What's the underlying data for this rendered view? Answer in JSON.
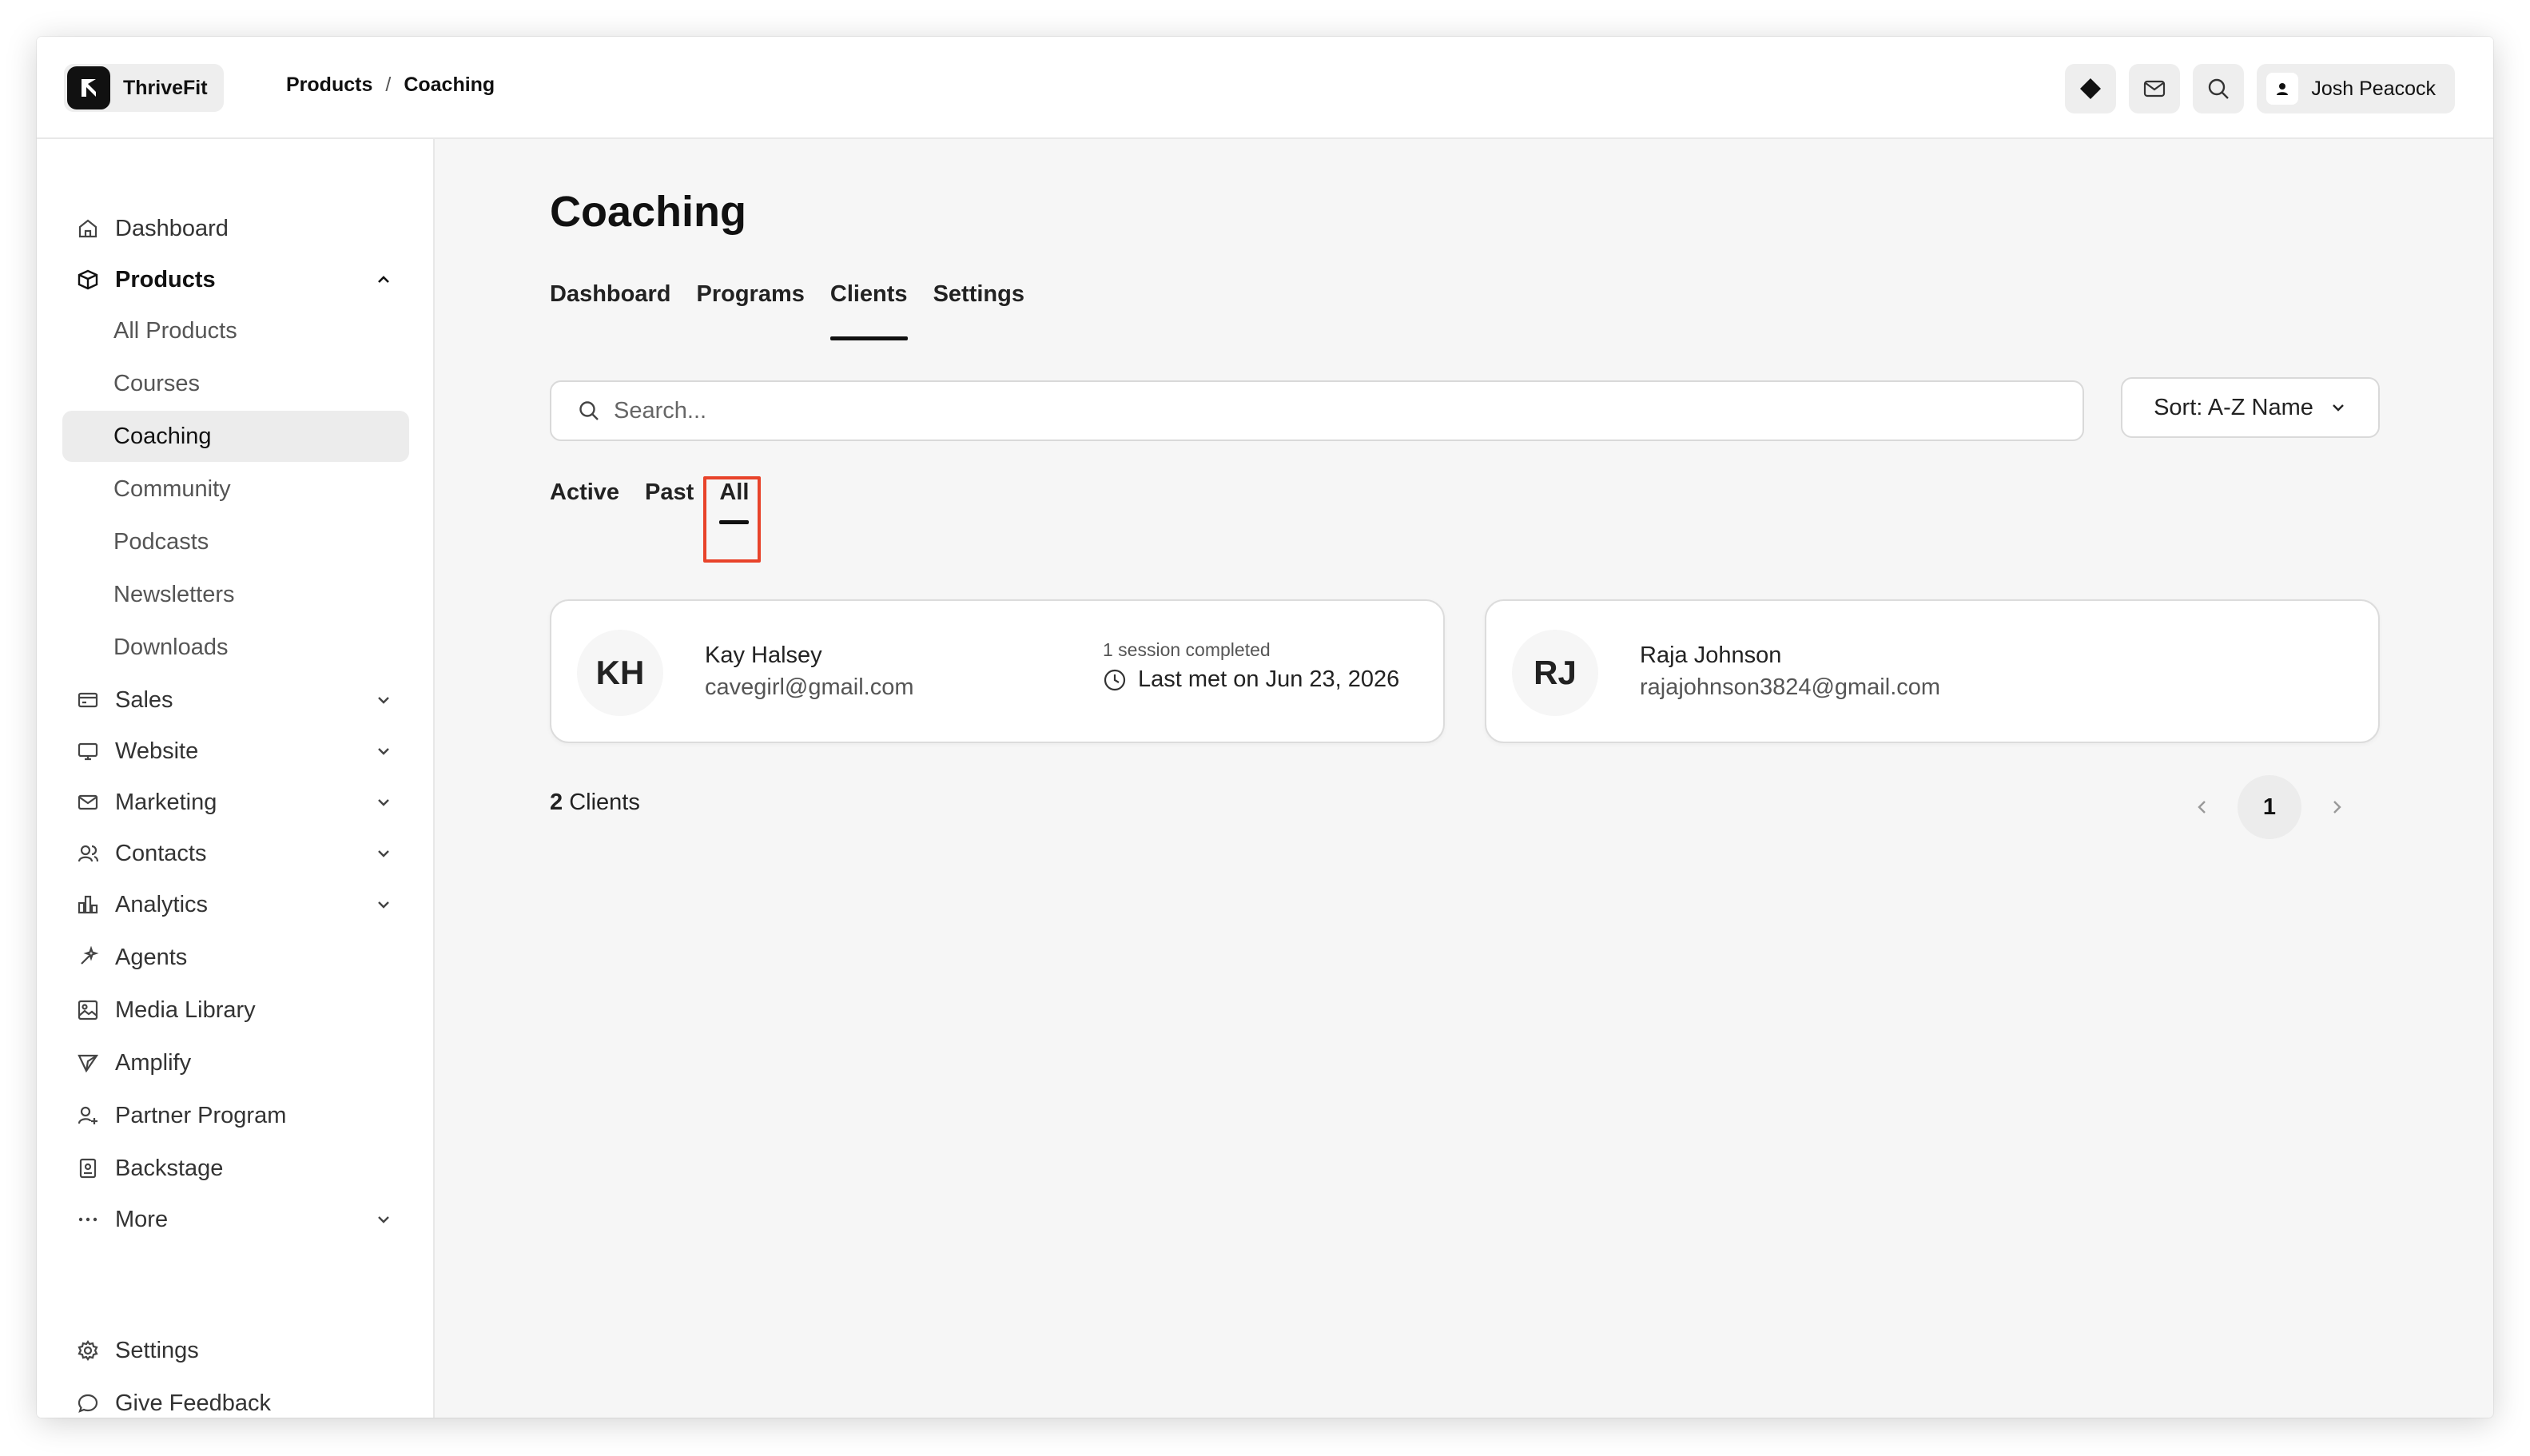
{
  "app": {
    "name": "ThriveFit"
  },
  "breadcrumb": {
    "items": [
      "Products",
      "Coaching"
    ],
    "separator": "/"
  },
  "user": {
    "name": "Josh Peacock"
  },
  "sidebar": {
    "items": [
      {
        "label": "Dashboard",
        "icon": "home-icon"
      },
      {
        "label": "Products",
        "icon": "box-icon",
        "expanded": true
      },
      {
        "label": "Sales",
        "icon": "credit-card-icon"
      },
      {
        "label": "Website",
        "icon": "monitor-icon"
      },
      {
        "label": "Marketing",
        "icon": "mail-icon"
      },
      {
        "label": "Contacts",
        "icon": "users-icon"
      },
      {
        "label": "Analytics",
        "icon": "bar-chart-icon"
      },
      {
        "label": "Agents",
        "icon": "sparkle-icon"
      },
      {
        "label": "Media Library",
        "icon": "image-icon"
      },
      {
        "label": "Amplify",
        "icon": "send-icon"
      },
      {
        "label": "Partner Program",
        "icon": "user-plus-icon"
      },
      {
        "label": "Backstage",
        "icon": "badge-icon"
      },
      {
        "label": "More",
        "icon": "more-icon"
      }
    ],
    "products_sub": [
      "All Products",
      "Courses",
      "Coaching",
      "Community",
      "Podcasts",
      "Newsletters",
      "Downloads"
    ],
    "active_sub": "Coaching",
    "footer": [
      {
        "label": "Settings",
        "icon": "gear-icon"
      },
      {
        "label": "Give Feedback",
        "icon": "chat-icon"
      }
    ]
  },
  "main": {
    "title": "Coaching",
    "tabs": [
      "Dashboard",
      "Programs",
      "Clients",
      "Settings"
    ],
    "active_tab": "Clients",
    "search_placeholder": "Search...",
    "sort_label": "Sort: A-Z Name",
    "filters": [
      "Active",
      "Past",
      "All"
    ],
    "active_filter": "All",
    "clients": [
      {
        "initials": "KH",
        "name": "Kay Halsey",
        "email": "cavegirl@gmail.com",
        "sessions": "1 session completed",
        "last_met": "Last met on Jun 23, 2026"
      },
      {
        "initials": "RJ",
        "name": "Raja Johnson",
        "email": "rajajohnson3824@gmail.com",
        "sessions": "",
        "last_met": ""
      }
    ],
    "count_number": "2",
    "count_label": "Clients",
    "page": "1"
  },
  "colors": {
    "highlight": "#e8432a",
    "active_bg": "#ececec"
  }
}
